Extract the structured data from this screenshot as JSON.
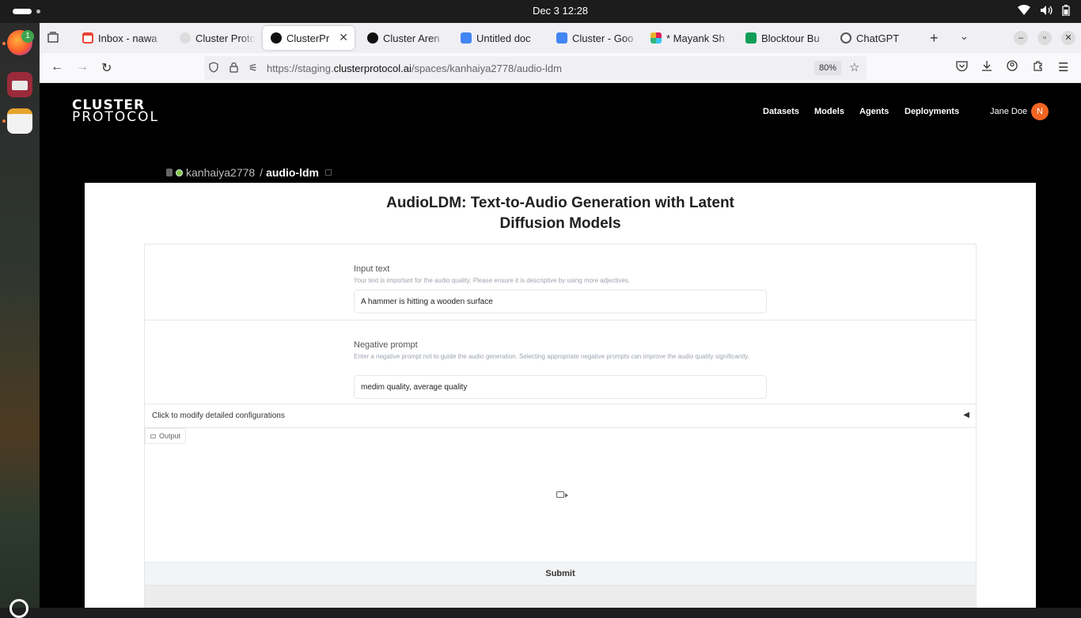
{
  "system": {
    "clock": "Dec 3  12:28",
    "tray_icons": [
      "wifi-icon",
      "volume-icon",
      "battery-icon"
    ]
  },
  "dock": {
    "apps": [
      "firefox",
      "files",
      "text-editor"
    ],
    "firefox_badge": "1"
  },
  "browser": {
    "tabs": [
      {
        "title": "Inbox - nawa",
        "icon": "gmail-icon",
        "color": "#ea4335",
        "active": false
      },
      {
        "title": "Cluster Proto",
        "icon": "cluster-icon",
        "color": "#cccccc",
        "active": false
      },
      {
        "title": "ClusterPr",
        "icon": "cluster-icon",
        "color": "#111111",
        "active": true
      },
      {
        "title": "Cluster Aren",
        "icon": "cluster-icon",
        "color": "#111111",
        "active": false
      },
      {
        "title": "Untitled doc",
        "icon": "docs-icon",
        "color": "#4285f4",
        "active": false
      },
      {
        "title": "Cluster - Goo",
        "icon": "docs-icon",
        "color": "#4285f4",
        "active": false
      },
      {
        "title": "* Mayank Sh",
        "icon": "slack-icon",
        "color": "#e01e5a",
        "active": false
      },
      {
        "title": "Blocktour Bu",
        "icon": "sheets-icon",
        "color": "#0f9d58",
        "active": false
      },
      {
        "title": "ChatGPT",
        "icon": "chatgpt-icon",
        "color": "#555555",
        "active": false
      }
    ],
    "url": {
      "prefix": "https://staging.",
      "host": "clusterprotocol.ai",
      "path": "/spaces/kanhaiya2778/audio-ldm"
    },
    "zoom": "80%"
  },
  "site": {
    "logo": {
      "line1": "CLUSTER",
      "line2": "PROTOCOL"
    },
    "nav": [
      "Datasets",
      "Models",
      "Agents",
      "Deployments"
    ],
    "user": {
      "name": "Jane Doe",
      "initial": "N"
    }
  },
  "breadcrumb": {
    "owner": "kanhaiya2778",
    "separator": "/",
    "repo": "audio-ldm"
  },
  "app": {
    "title": "AudioLDM: Text-to-Audio Generation with Latent Diffusion Models",
    "input_text": {
      "label": "Input text",
      "description": "Your text is important for the audio quality. Please ensure it is descriptive by using more adjectives.",
      "value": "A hammer is hitting a wooden surface"
    },
    "negative_prompt": {
      "label": "Negative prompt",
      "description": "Enter a negative prompt not to guide the audio generation. Selecting appropriate negative prompts can improve the audio quality significantly.",
      "value": "medim quality, average quality"
    },
    "accordion_label": "Click to modify detailed configurations",
    "accordion_arrow": "◀",
    "output_label": "Output",
    "submit_label": "Submit"
  }
}
